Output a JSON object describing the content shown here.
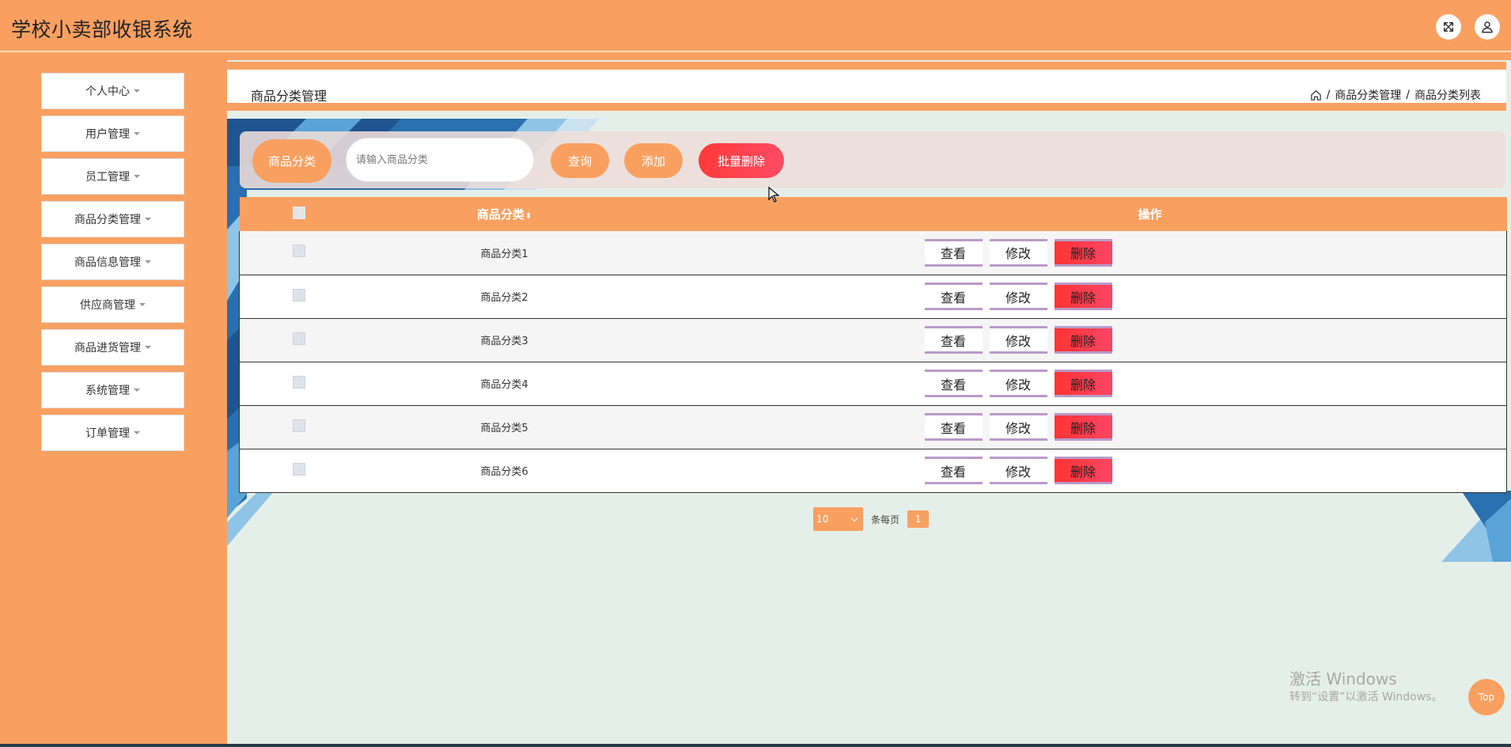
{
  "app": {
    "title": "学校小卖部收银系统"
  },
  "header": {
    "fullscreen_icon": "fullscreen-icon",
    "user_icon": "user-icon"
  },
  "sidebar": {
    "items": [
      {
        "label": "个人中心"
      },
      {
        "label": "用户管理"
      },
      {
        "label": "员工管理"
      },
      {
        "label": "商品分类管理"
      },
      {
        "label": "商品信息管理"
      },
      {
        "label": "供应商管理"
      },
      {
        "label": "商品进货管理"
      },
      {
        "label": "系统管理"
      },
      {
        "label": "订单管理"
      }
    ]
  },
  "page": {
    "title": "商品分类管理",
    "breadcrumb": {
      "home_icon": "home-icon",
      "sep1": "/",
      "level1": "商品分类管理",
      "sep2": "/",
      "level2": "商品分类列表"
    }
  },
  "search": {
    "label": "商品分类",
    "placeholder": "请输入商品分类",
    "query_label": "查询",
    "add_label": "添加",
    "batch_delete_label": "批量删除"
  },
  "table": {
    "headers": {
      "name": "商品分类",
      "sort": "⬍",
      "ops": "操作"
    },
    "rows": [
      {
        "name": "商品分类1"
      },
      {
        "name": "商品分类2"
      },
      {
        "name": "商品分类3"
      },
      {
        "name": "商品分类4"
      },
      {
        "name": "商品分类5"
      },
      {
        "name": "商品分类6"
      }
    ],
    "op_labels": {
      "view": "查看",
      "edit": "修改",
      "delete": "删除"
    }
  },
  "pagination": {
    "page_size": "10",
    "per_page_text": "条每页",
    "current_page": "1"
  },
  "watermark": {
    "line1": "激活 Windows",
    "line2": "转到“设置”以激活 Windows。"
  },
  "back_to_top": "Top",
  "colors": {
    "primary": "#f9a061",
    "danger": "#ff3b3b",
    "content_bg": "#e5efe9",
    "op_border": "#b99ac9"
  }
}
